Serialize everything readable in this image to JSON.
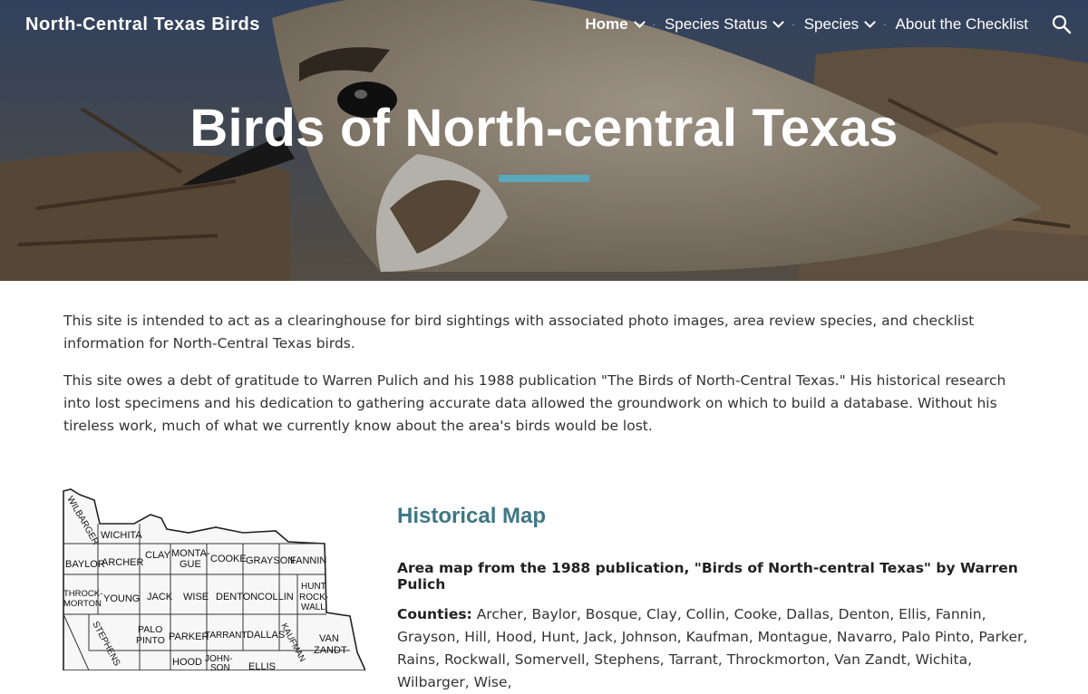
{
  "header": {
    "site_title": "North-Central Texas Birds",
    "nav": [
      {
        "label": "Home",
        "active": true,
        "has_dropdown": true
      },
      {
        "label": "Species Status",
        "active": false,
        "has_dropdown": true
      },
      {
        "label": "Species",
        "active": false,
        "has_dropdown": true
      },
      {
        "label": "About the Checklist",
        "active": false,
        "has_dropdown": false
      }
    ],
    "search_icon": "search-icon"
  },
  "hero": {
    "title": "Birds of North-central Texas",
    "accent_color": "#5aa8bb"
  },
  "intro": {
    "paragraph1": "This site is intended to act as a clearinghouse for bird sightings with associated photo images, area review species, and checklist information for North-Central Texas birds.",
    "paragraph2": "This site owes a debt of gratitude to Warren Pulich and his 1988 publication \"The Birds of North-Central Texas.\" His historical research into lost specimens and his dedication to gathering accurate data allowed the groundwork on which to build a database. Without his tireless work, much of what we currently know about the area's birds would be lost."
  },
  "map_section": {
    "heading": "Historical Map",
    "heading_color": "#3d7785",
    "caption": "Area map from the 1988 publication, \"Birds of North-central Texas\" by Warren Pulich",
    "counties_label": "Counties:",
    "counties_text": "Archer, Baylor, Bosque, Clay, Collin, Cooke, Dallas, Denton, Ellis, Fannin, Grayson, Hill, Hood, Hunt, Jack, Johnson, Kaufman, Montague, Navarro, Palo Pinto, Parker, Rains, Rockwall, Somervell, Stephens, Tarrant, Throckmorton, Van Zandt, Wichita, Wilbarger, Wise,"
  },
  "map_labels": {
    "wilbarger": "WILBARGER",
    "wichita": "WICHITA",
    "baylor": "BAYLOR",
    "archer": "ARCHER",
    "clay": "CLAY",
    "montague1": "MONTA-",
    "montague2": "GUE",
    "cooke": "COOKE",
    "grayson": "GRAYSON",
    "fannin": "FANNIN",
    "throck1": "THROCK-",
    "throck2": "MORTON",
    "young": "YOUNG",
    "jack": "JACK",
    "wise": "WISE",
    "denton": "DENTON",
    "collin": "COLLIN",
    "hunt": "HUNT",
    "rockwall1": "ROCK-",
    "rockwall2": "WALL",
    "stephens": "STEPHENS",
    "palopinto1": "PALO",
    "palopinto2": "PINTO",
    "parker": "PARKER",
    "tarrant": "TARRANT",
    "dallas": "DALLAS",
    "kaufman": "KAUFMAN",
    "vanzandt1": "VAN",
    "vanzandt2": "ZANDT",
    "hood": "HOOD",
    "johnson1": "JOHN-",
    "johnson2": "SON",
    "ellis": "ELLIS"
  }
}
